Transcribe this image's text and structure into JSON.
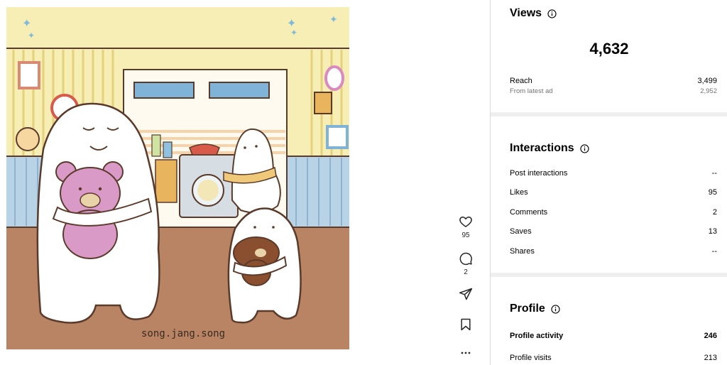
{
  "post": {
    "image_signature": "song.jang.song",
    "likes_count": "95",
    "comments_count": "2"
  },
  "actions": {
    "like_icon": "heart-outline-icon",
    "comment_icon": "comment-bubble-icon",
    "share_icon": "paper-plane-icon",
    "save_icon": "bookmark-icon",
    "more_icon": "more-horizontal-icon"
  },
  "insights": {
    "views": {
      "title": "Views",
      "total": "4,632",
      "reach_label": "Reach",
      "reach_value": "3,499",
      "ad_label": "From latest ad",
      "ad_value": "2,952"
    },
    "interactions": {
      "title": "Interactions",
      "rows": [
        {
          "label": "Post interactions",
          "value": "--"
        },
        {
          "label": "Likes",
          "value": "95"
        },
        {
          "label": "Comments",
          "value": "2"
        },
        {
          "label": "Saves",
          "value": "13"
        },
        {
          "label": "Shares",
          "value": "--"
        }
      ]
    },
    "profile": {
      "title": "Profile",
      "activity_label": "Profile activity",
      "activity_value": "246",
      "visits_label": "Profile visits",
      "visits_value": "213"
    }
  },
  "colors": {
    "wall_yellow": "#f7eeb6",
    "wall_blue": "#b9d3e6",
    "floor_brown": "#b88464",
    "teddy_pink": "#d99ac8",
    "teddy_brown": "#8a4f2e",
    "separator": "#efefef",
    "muted_text": "#737373"
  }
}
